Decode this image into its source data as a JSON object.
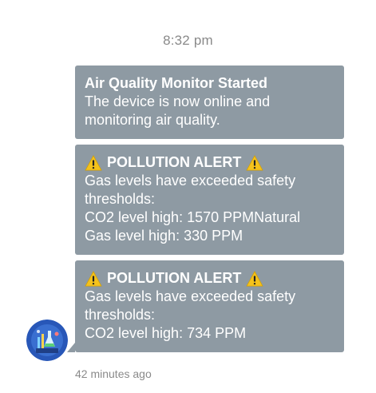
{
  "chat": {
    "timestamp": "8:32 pm",
    "footer_time": "42 minutes ago",
    "avatar_icon": "lab-bot-avatar-icon",
    "bubble_color": "#8e9aa3",
    "messages": [
      {
        "title": "Air Quality Monitor Started",
        "body": "The device is now online and\nmonitoring air quality."
      },
      {
        "title": "POLLUTION ALERT",
        "title_icon": "warning-icon",
        "body": "Gas levels have exceeded safety\nthresholds:\nCO2 level high: 1570 PPMNatural\nGas level high: 330 PPM"
      },
      {
        "title": "POLLUTION ALERT",
        "title_icon": "warning-icon",
        "body": "Gas levels have exceeded safety\nthresholds:\nCO2 level high: 734 PPM"
      }
    ]
  }
}
